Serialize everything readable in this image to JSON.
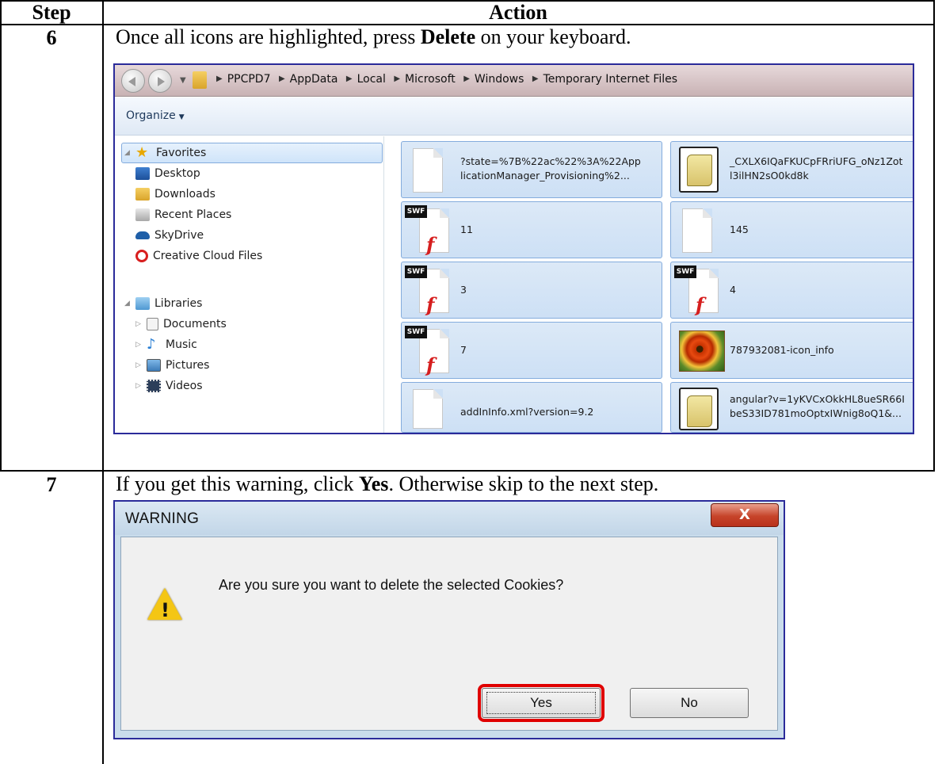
{
  "table": {
    "header_step": "Step",
    "header_action": "Action"
  },
  "step6": {
    "number": "6",
    "instruction_before": "Once all icons are highlighted, press ",
    "instruction_bold": "Delete",
    "instruction_after": " on your keyboard."
  },
  "explorer": {
    "breadcrumbs": [
      "PPCPD7",
      "AppData",
      "Local",
      "Microsoft",
      "Windows",
      "Temporary Internet Files"
    ],
    "organize_label": "Organize",
    "nav": {
      "favorites": "Favorites",
      "desktop": "Desktop",
      "downloads": "Downloads",
      "recent_places": "Recent Places",
      "skydrive": "SkyDrive",
      "creative_cloud": "Creative Cloud Files",
      "libraries": "Libraries",
      "documents": "Documents",
      "music": "Music",
      "pictures": "Pictures",
      "videos": "Videos"
    },
    "files": [
      {
        "line1": "?state=%7B%22ac%22%3A%22App",
        "line2": "licationManager_Provisioning%2...",
        "icon": "blank-file-icon"
      },
      {
        "line1": "_CXLX6IQaFKUCpFRriUFG_oNz1Zot",
        "line2": "l3ilHN2sO0kd8k",
        "icon": "script-file-icon"
      },
      {
        "line1": "11",
        "line2": "",
        "icon": "swf-file-icon"
      },
      {
        "line1": "145",
        "line2": "",
        "icon": "blank-file-icon"
      },
      {
        "line1": "3",
        "line2": "",
        "icon": "swf-file-icon"
      },
      {
        "line1": "4",
        "line2": "",
        "icon": "swf-file-icon"
      },
      {
        "line1": "7",
        "line2": "",
        "icon": "swf-file-icon"
      },
      {
        "line1": "787932081-icon_info",
        "line2": "",
        "icon": "flower-image-icon"
      },
      {
        "line1": "addInInfo.xml?version=9.2",
        "line2": "",
        "icon": "blank-file-icon"
      },
      {
        "line1": "angular?v=1yKVCxOkkHL8ueSR66I",
        "line2": "beS33ID781moOptxIWnig8oQ1&...",
        "icon": "script-file-icon"
      }
    ],
    "swf_badge": "SWF"
  },
  "step7": {
    "number": "7",
    "instruction_before": "If you get this warning, click ",
    "instruction_bold": "Yes",
    "instruction_after": ". Otherwise skip to the next step."
  },
  "dialog": {
    "title": "WARNING",
    "close_label": "X",
    "message": "Are you sure you want to delete the selected Cookies?",
    "yes_label": "Yes",
    "no_label": "No"
  },
  "colors": {
    "highlight_outline": "#e00000",
    "screenshot_border": "#2b2b9a",
    "tile_selected": "#cde0f5"
  }
}
